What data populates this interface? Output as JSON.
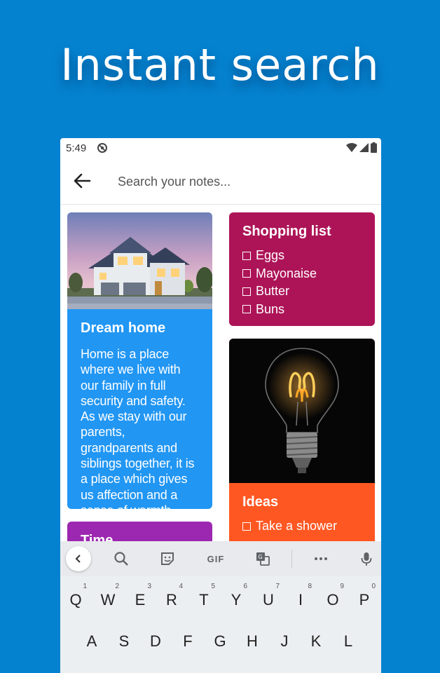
{
  "headline": "Instant search",
  "status_bar": {
    "time": "5:49"
  },
  "search": {
    "placeholder": "Search your notes..."
  },
  "notes": {
    "dream_home": {
      "title": "Dream home",
      "body": "Home is a place where we live with our family in full security and safety. As we stay with our parents, grandparents and siblings together, it is a place which gives us affection and a sense of warmth.",
      "color": "#2196f3"
    },
    "shopping_list": {
      "title": "Shopping list",
      "items": [
        "Eggs",
        "Mayonaise",
        "Butter",
        "Buns"
      ],
      "color": "#ad1457"
    },
    "ideas": {
      "title": "Ideas",
      "items": [
        "Take a shower"
      ],
      "color": "#ff5722"
    },
    "time": {
      "title": "Time",
      "color": "#9c27b0"
    }
  },
  "keyboard": {
    "toolbar": [
      "back-icon",
      "search-icon",
      "sticker-icon",
      "gif-icon",
      "translate-icon",
      "more-icon",
      "mic-icon"
    ],
    "gif_label": "GIF",
    "row1": [
      {
        "key": "Q",
        "hint": "1"
      },
      {
        "key": "W",
        "hint": "2"
      },
      {
        "key": "E",
        "hint": "3"
      },
      {
        "key": "R",
        "hint": "4"
      },
      {
        "key": "T",
        "hint": "5"
      },
      {
        "key": "Y",
        "hint": "6"
      },
      {
        "key": "U",
        "hint": "7"
      },
      {
        "key": "I",
        "hint": "8"
      },
      {
        "key": "O",
        "hint": "9"
      },
      {
        "key": "P",
        "hint": "0"
      }
    ],
    "row2": [
      "A",
      "S",
      "D",
      "F",
      "G",
      "H",
      "J",
      "K",
      "L"
    ]
  }
}
